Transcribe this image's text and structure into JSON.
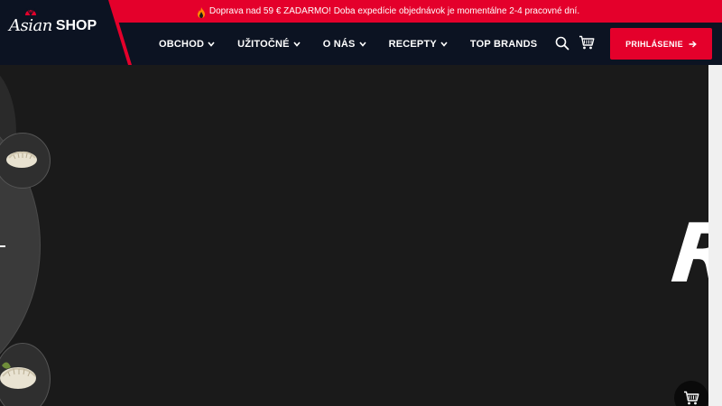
{
  "promo": {
    "text": "Doprava nad 59 € ZADARMO! Doba expedície objednávok je momentálne 2-4 pracovné dní.",
    "icon": "flame-icon"
  },
  "logo": {
    "asian": "Asian",
    "shop": "SHOP"
  },
  "nav": {
    "items": [
      {
        "label": "OBCHOD",
        "has_dropdown": true
      },
      {
        "label": "UŽITOČNÉ",
        "has_dropdown": true
      },
      {
        "label": "O NÁS",
        "has_dropdown": true
      },
      {
        "label": "RECEPTY",
        "has_dropdown": true
      },
      {
        "label": "TOP BRANDS",
        "has_dropdown": false
      }
    ]
  },
  "header_icons": {
    "search": "search-icon",
    "cart": "cart-icon"
  },
  "login": {
    "label": "PRIHLÁSENIE",
    "icon": "arrow-right-icon"
  },
  "hero": {
    "letter": "R"
  },
  "colors": {
    "accent": "#e4002b",
    "header_bg": "#0c1322",
    "hero_bg": "#1a1a1a"
  }
}
